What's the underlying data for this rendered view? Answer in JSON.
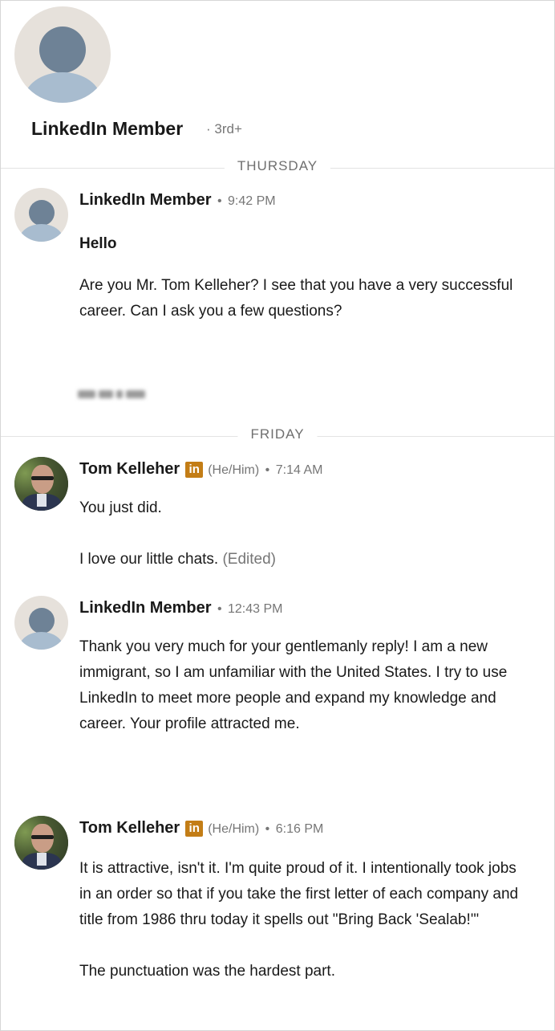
{
  "header": {
    "name": "LinkedIn Member",
    "degree": "· 3rd+"
  },
  "days": [
    "THURSDAY",
    "FRIDAY"
  ],
  "messages": [
    {
      "sender": "LinkedIn Member",
      "separator": "•",
      "time": "9:42 PM",
      "subject": "Hello",
      "text": "Are you Mr. Tom Kelleher? I see that you have a very successful career. Can I ask you a few questions?"
    },
    {
      "sender": "Tom Kelleher",
      "badge": "in",
      "pronouns": "(He/Him)",
      "separator": "•",
      "time": "7:14 AM",
      "text1": "You just did.",
      "text2": "I love our little chats.",
      "edited": "(Edited)"
    },
    {
      "sender": "LinkedIn Member",
      "separator": "•",
      "time": "12:43 PM",
      "text": "Thank you very much for your gentlemanly reply! I am a new immigrant, so I am unfamiliar with the United States. I try to use LinkedIn to meet more people and expand my knowledge and career. Your profile attracted me."
    },
    {
      "sender": "Tom Kelleher",
      "badge": "in",
      "pronouns": "(He/Him)",
      "separator": "•",
      "time": "6:16 PM",
      "text1": "It is attractive, isn't it. I'm quite proud of it. I intentionally took jobs in an order so that if you take the first letter of each company and title from 1986 thru today it spells out \"Bring Back 'Sealab!'\"",
      "text2": "The punctuation was the hardest part."
    }
  ],
  "colors": {
    "badge": "#c37d16",
    "muted_text": "#767676",
    "divider": "#e3e3e3"
  },
  "icons": {
    "default_avatar": "person-silhouette",
    "linkedin_badge": "linkedin-premium-icon"
  }
}
